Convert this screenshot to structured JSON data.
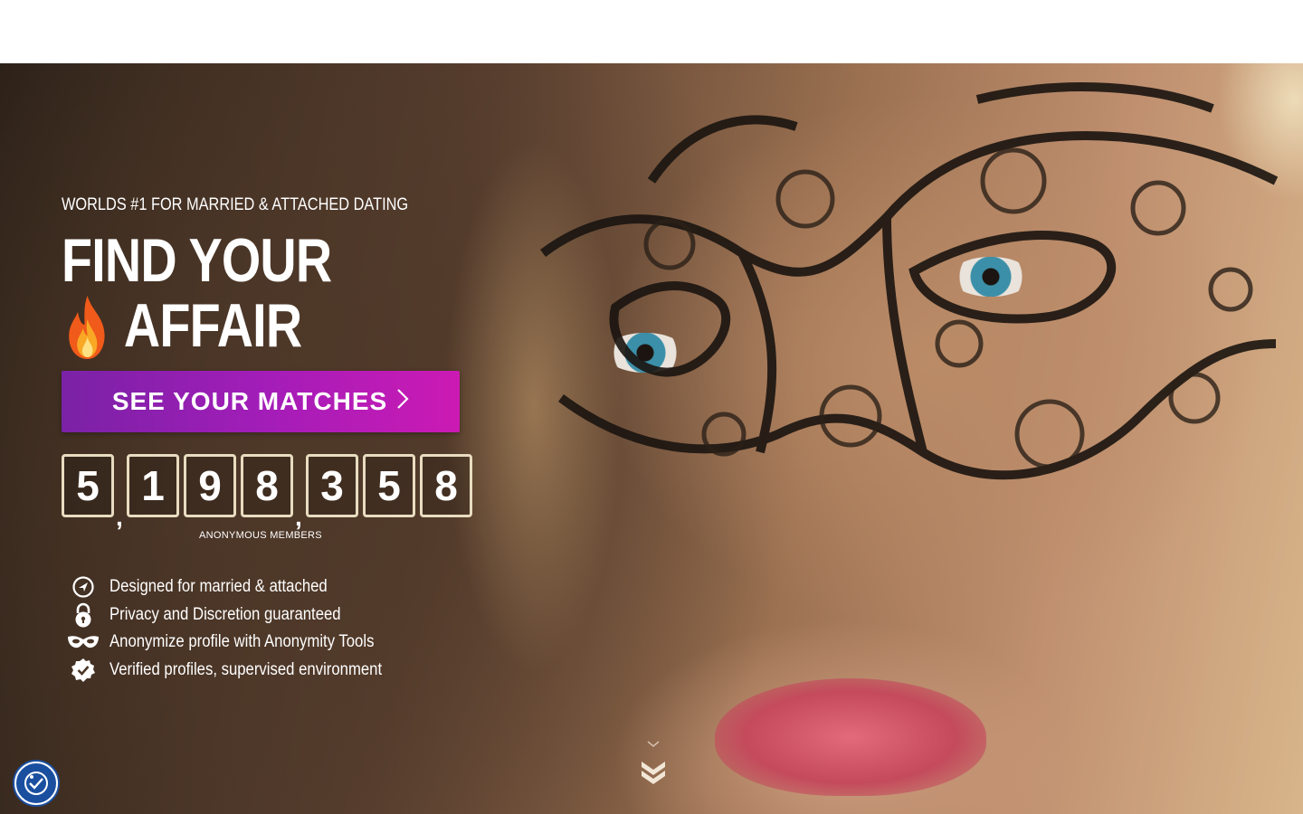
{
  "hero": {
    "kicker": "WORLDS #1 FOR MARRIED & ATTACHED DATING",
    "headline_line1": "FIND YOUR",
    "headline_line2": "AFFAIR",
    "fire_icon": "fire-emoji-icon",
    "cta_label": "SEE YOUR MATCHES",
    "cta_icon": "chevron-right-icon",
    "cta_colors": [
      "#7a22a6",
      "#cc1ab4"
    ]
  },
  "counter": {
    "groups": [
      "5",
      "198",
      "358"
    ],
    "digits": [
      "5",
      "1",
      "9",
      "8",
      "3",
      "5",
      "8"
    ],
    "separator": ",",
    "label": "ANONYMOUS MEMBERS"
  },
  "features": [
    {
      "icon": "navigation-arrow-icon",
      "text": "Designed for married & attached"
    },
    {
      "icon": "padlock-icon",
      "text": "Privacy and Discretion guaranteed"
    },
    {
      "icon": "masquerade-mask-icon",
      "text": "Anonymize profile with Anonymity Tools"
    },
    {
      "icon": "verified-badge-icon",
      "text": "Verified profiles, supervised environment"
    }
  ],
  "scroll_icon": "double-chevron-down-icon",
  "accessibility_icon": "accessibility-check-icon",
  "colors": {
    "accent_purple": "#a21db8",
    "digit_border": "#e8dcc0",
    "accessibility_blue": "#1a4fa0"
  }
}
